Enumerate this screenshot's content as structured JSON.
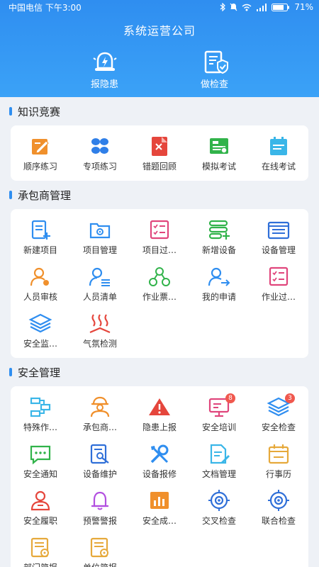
{
  "status": {
    "carrier": "中国电信 下午3:00",
    "battery": "71%"
  },
  "header": {
    "title": "系统运营公司"
  },
  "quick_actions": [
    {
      "label": "报隐患",
      "icon": "hazard-bell-icon"
    },
    {
      "label": "做检查",
      "icon": "inspection-doc-icon"
    }
  ],
  "sections": [
    {
      "title": "知识竞赛",
      "items": [
        {
          "label": "顺序练习",
          "icon": "pencil-note-icon",
          "color": "#f0902c"
        },
        {
          "label": "专项练习",
          "icon": "four-leaf-icon",
          "color": "#2f7fe8"
        },
        {
          "label": "错题回顾",
          "icon": "wrong-answer-icon",
          "color": "#e5463c"
        },
        {
          "label": "模拟考试",
          "icon": "mock-exam-icon",
          "color": "#31b34a"
        },
        {
          "label": "在线考试",
          "icon": "online-exam-icon",
          "color": "#3ab6e8"
        }
      ]
    },
    {
      "title": "承包商管理",
      "items": [
        {
          "label": "新建项目",
          "icon": "new-project-icon",
          "color": "#2f8ef0"
        },
        {
          "label": "项目管理",
          "icon": "project-folder-icon",
          "color": "#2f8ef0"
        },
        {
          "label": "项目过…",
          "icon": "checklist-icon",
          "color": "#e0467c"
        },
        {
          "label": "新增设备",
          "icon": "add-device-icon",
          "color": "#31b34a"
        },
        {
          "label": "设备管理",
          "icon": "device-manage-icon",
          "color": "#2f6fd8"
        },
        {
          "label": "人员审核",
          "icon": "person-review-icon",
          "color": "#f0902c"
        },
        {
          "label": "人员清单",
          "icon": "person-list-icon",
          "color": "#2f8ef0"
        },
        {
          "label": "作业票…",
          "icon": "work-ticket-icon",
          "color": "#31b34a"
        },
        {
          "label": "我的申请",
          "icon": "my-apply-icon",
          "color": "#2f8ef0"
        },
        {
          "label": "作业过…",
          "icon": "checklist-icon",
          "color": "#e0467c"
        },
        {
          "label": "安全监…",
          "icon": "layers-icon",
          "color": "#2f8ef0"
        },
        {
          "label": "气氛检测",
          "icon": "gas-detect-icon",
          "color": "#e5463c"
        }
      ]
    },
    {
      "title": "安全管理",
      "items": [
        {
          "label": "特殊作…",
          "icon": "special-work-icon",
          "color": "#3ab6e8"
        },
        {
          "label": "承包商…",
          "icon": "contractor-worker-icon",
          "color": "#f0902c"
        },
        {
          "label": "隐患上报",
          "icon": "warning-triangle-icon",
          "color": "#e5463c"
        },
        {
          "label": "安全培训",
          "icon": "training-screen-icon",
          "color": "#e0467c",
          "badge": "8"
        },
        {
          "label": "安全检查",
          "icon": "layers-icon",
          "color": "#2f8ef0",
          "badge": "3"
        },
        {
          "label": "安全通知",
          "icon": "message-icon",
          "color": "#31b34a"
        },
        {
          "label": "设备维护",
          "icon": "doc-search-icon",
          "color": "#2f6fd8"
        },
        {
          "label": "设备报修",
          "icon": "wrench-icon",
          "color": "#2f8ef0"
        },
        {
          "label": "文档管理",
          "icon": "doc-edit-icon",
          "color": "#3ab6e8"
        },
        {
          "label": "行事历",
          "icon": "calendar-icon",
          "color": "#e6a93b"
        },
        {
          "label": "安全履职",
          "icon": "duty-person-icon",
          "color": "#e5463c"
        },
        {
          "label": "预警警报",
          "icon": "alarm-bell-icon",
          "color": "#b24fe0"
        },
        {
          "label": "安全成…",
          "icon": "chart-box-icon",
          "color": "#f0902c"
        },
        {
          "label": "交叉检查",
          "icon": "target-icon",
          "color": "#2f6fd8"
        },
        {
          "label": "联合检查",
          "icon": "target-icon",
          "color": "#2f6fd8"
        },
        {
          "label": "部门简报",
          "icon": "report-icon",
          "color": "#e6a93b"
        },
        {
          "label": "单位简报",
          "icon": "report-icon",
          "color": "#e6a93b"
        }
      ]
    }
  ]
}
